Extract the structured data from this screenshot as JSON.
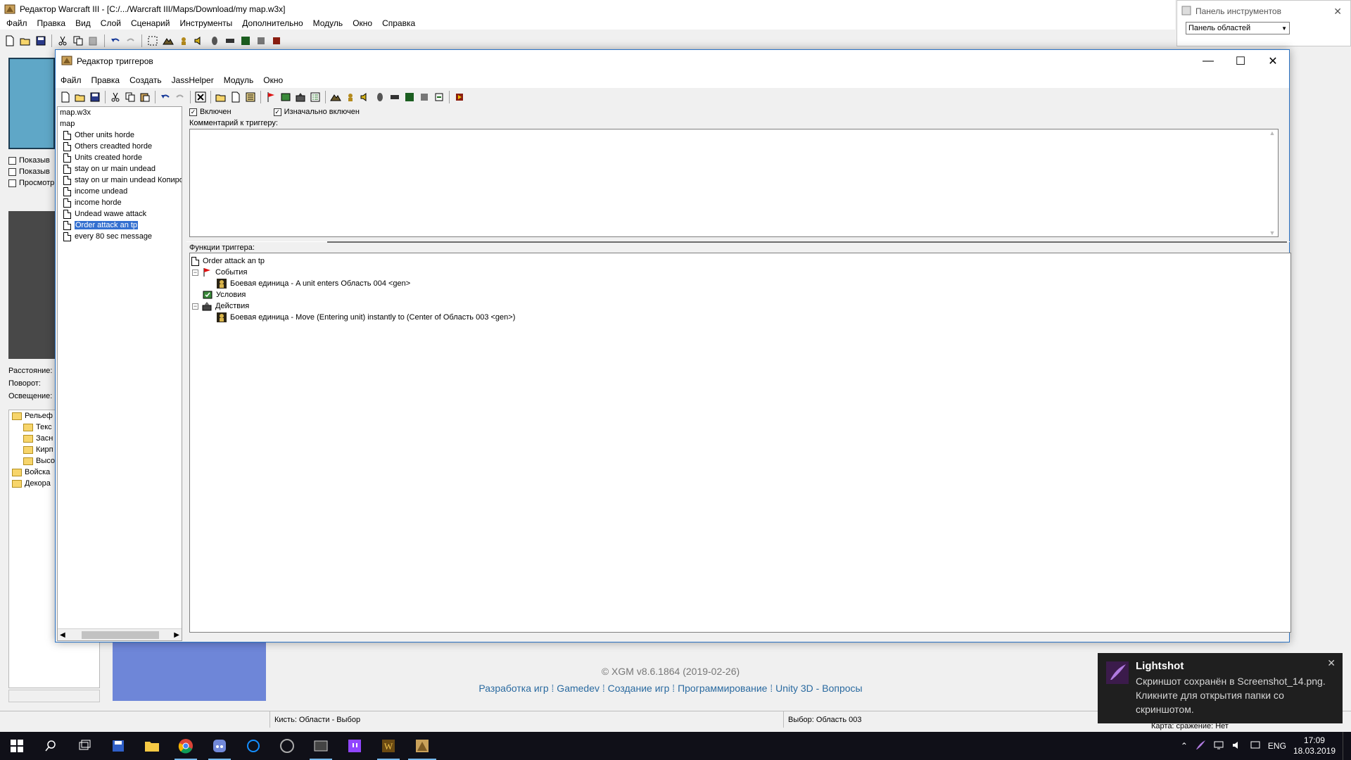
{
  "main_window": {
    "title": "Редактор Warcraft III  - [C:/.../Warcraft III/Maps/Download/my map.w3x]",
    "menu": [
      "Файл",
      "Правка",
      "Вид",
      "Слой",
      "Сценарий",
      "Инструменты",
      "Дополнительно",
      "Модуль",
      "Окно",
      "Справка"
    ]
  },
  "left_panel": {
    "checkboxes": [
      "Показыв",
      "Показыв",
      "Просмотр"
    ],
    "props": [
      "Расстояние:",
      "Поворот:",
      "Освещение:"
    ],
    "tree": [
      {
        "label": "Рельеф",
        "level": 0
      },
      {
        "label": "Текс",
        "level": 1
      },
      {
        "label": "Засн",
        "level": 1
      },
      {
        "label": "Кирп",
        "level": 1
      },
      {
        "label": "Высо",
        "level": 1
      },
      {
        "label": "Войска",
        "level": 0
      },
      {
        "label": "Декора",
        "level": 0
      }
    ]
  },
  "tool_palette": {
    "title": "Панель инструментов",
    "select_value": "Панель областей"
  },
  "trigger_editor": {
    "title": "Редактор триггеров",
    "menu": [
      "Файл",
      "Правка",
      "Создать",
      "JassHelper",
      "Модуль",
      "Окно"
    ],
    "tree_root": "map.w3x",
    "tree_category": "map",
    "triggers": [
      "Other units horde",
      "Others creadted horde",
      "Units created horde",
      "stay on ur main undead",
      "stay on ur main undead Копиро",
      "income undead",
      "income horde",
      "Undead wawe attack",
      "Order attack an tp",
      "every 80 sec message"
    ],
    "selected_trigger": "Order attack an tp",
    "enabled_label": "Включен",
    "enabled_checked": true,
    "initially_on_label": "Изначально включен",
    "initially_on_checked": true,
    "comment_label": "Комментарий к триггеру:",
    "comment_text": "",
    "functions_label": "Функции триггера:",
    "functions": {
      "name": "Order attack an tp",
      "events_label": "События",
      "event_1": "Боевая единица - A unit enters Область 004 <gen>",
      "conditions_label": "Условия",
      "actions_label": "Действия",
      "action_1": "Боевая единица - Move (Entering unit) instantly to (Center of Область 003 <gen>)"
    }
  },
  "web_footer": {
    "credit": "© XGM v8.6.1864 (2019-02-26)",
    "links": "Разработка игр ⁞ Gamedev ⁞ Создание игр ⁞ Программирование ⁞ Unity 3D - Вопросы"
  },
  "statusbar": {
    "brush": "Кисть: Области - Выбор",
    "selection": "Выбор: Область 003",
    "map_status": "Карта: сражение: Нет"
  },
  "toast": {
    "title": "Lightshot",
    "body": "Скриншот сохранён в Screenshot_14.png. Кликните для открытия папки со скриншотом."
  },
  "taskbar": {
    "language": "ENG",
    "time": "17:09",
    "date": "18.03.2019"
  }
}
